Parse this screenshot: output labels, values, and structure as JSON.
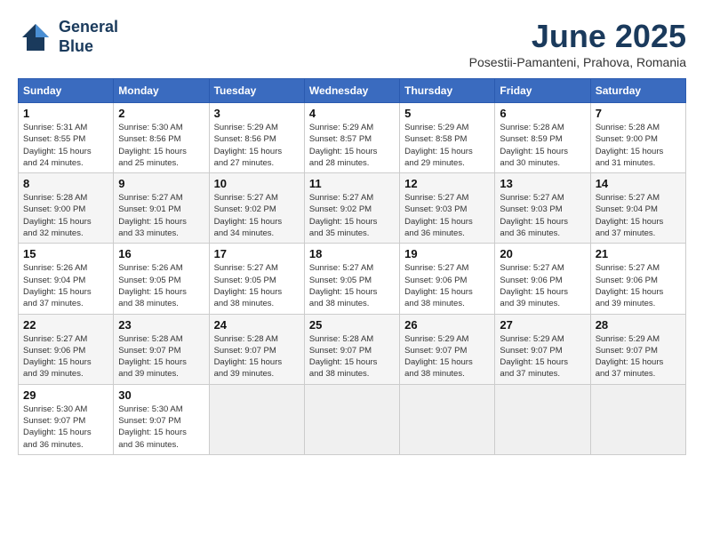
{
  "header": {
    "logo_line1": "General",
    "logo_line2": "Blue",
    "month": "June 2025",
    "location": "Posestii-Pamanteni, Prahova, Romania"
  },
  "weekdays": [
    "Sunday",
    "Monday",
    "Tuesday",
    "Wednesday",
    "Thursday",
    "Friday",
    "Saturday"
  ],
  "weeks": [
    [
      {
        "day": "1",
        "info": "Sunrise: 5:31 AM\nSunset: 8:55 PM\nDaylight: 15 hours\nand 24 minutes."
      },
      {
        "day": "2",
        "info": "Sunrise: 5:30 AM\nSunset: 8:56 PM\nDaylight: 15 hours\nand 25 minutes."
      },
      {
        "day": "3",
        "info": "Sunrise: 5:29 AM\nSunset: 8:56 PM\nDaylight: 15 hours\nand 27 minutes."
      },
      {
        "day": "4",
        "info": "Sunrise: 5:29 AM\nSunset: 8:57 PM\nDaylight: 15 hours\nand 28 minutes."
      },
      {
        "day": "5",
        "info": "Sunrise: 5:29 AM\nSunset: 8:58 PM\nDaylight: 15 hours\nand 29 minutes."
      },
      {
        "day": "6",
        "info": "Sunrise: 5:28 AM\nSunset: 8:59 PM\nDaylight: 15 hours\nand 30 minutes."
      },
      {
        "day": "7",
        "info": "Sunrise: 5:28 AM\nSunset: 9:00 PM\nDaylight: 15 hours\nand 31 minutes."
      }
    ],
    [
      {
        "day": "8",
        "info": "Sunrise: 5:28 AM\nSunset: 9:00 PM\nDaylight: 15 hours\nand 32 minutes."
      },
      {
        "day": "9",
        "info": "Sunrise: 5:27 AM\nSunset: 9:01 PM\nDaylight: 15 hours\nand 33 minutes."
      },
      {
        "day": "10",
        "info": "Sunrise: 5:27 AM\nSunset: 9:02 PM\nDaylight: 15 hours\nand 34 minutes."
      },
      {
        "day": "11",
        "info": "Sunrise: 5:27 AM\nSunset: 9:02 PM\nDaylight: 15 hours\nand 35 minutes."
      },
      {
        "day": "12",
        "info": "Sunrise: 5:27 AM\nSunset: 9:03 PM\nDaylight: 15 hours\nand 36 minutes."
      },
      {
        "day": "13",
        "info": "Sunrise: 5:27 AM\nSunset: 9:03 PM\nDaylight: 15 hours\nand 36 minutes."
      },
      {
        "day": "14",
        "info": "Sunrise: 5:27 AM\nSunset: 9:04 PM\nDaylight: 15 hours\nand 37 minutes."
      }
    ],
    [
      {
        "day": "15",
        "info": "Sunrise: 5:26 AM\nSunset: 9:04 PM\nDaylight: 15 hours\nand 37 minutes."
      },
      {
        "day": "16",
        "info": "Sunrise: 5:26 AM\nSunset: 9:05 PM\nDaylight: 15 hours\nand 38 minutes."
      },
      {
        "day": "17",
        "info": "Sunrise: 5:27 AM\nSunset: 9:05 PM\nDaylight: 15 hours\nand 38 minutes."
      },
      {
        "day": "18",
        "info": "Sunrise: 5:27 AM\nSunset: 9:05 PM\nDaylight: 15 hours\nand 38 minutes."
      },
      {
        "day": "19",
        "info": "Sunrise: 5:27 AM\nSunset: 9:06 PM\nDaylight: 15 hours\nand 38 minutes."
      },
      {
        "day": "20",
        "info": "Sunrise: 5:27 AM\nSunset: 9:06 PM\nDaylight: 15 hours\nand 39 minutes."
      },
      {
        "day": "21",
        "info": "Sunrise: 5:27 AM\nSunset: 9:06 PM\nDaylight: 15 hours\nand 39 minutes."
      }
    ],
    [
      {
        "day": "22",
        "info": "Sunrise: 5:27 AM\nSunset: 9:06 PM\nDaylight: 15 hours\nand 39 minutes."
      },
      {
        "day": "23",
        "info": "Sunrise: 5:28 AM\nSunset: 9:07 PM\nDaylight: 15 hours\nand 39 minutes."
      },
      {
        "day": "24",
        "info": "Sunrise: 5:28 AM\nSunset: 9:07 PM\nDaylight: 15 hours\nand 39 minutes."
      },
      {
        "day": "25",
        "info": "Sunrise: 5:28 AM\nSunset: 9:07 PM\nDaylight: 15 hours\nand 38 minutes."
      },
      {
        "day": "26",
        "info": "Sunrise: 5:29 AM\nSunset: 9:07 PM\nDaylight: 15 hours\nand 38 minutes."
      },
      {
        "day": "27",
        "info": "Sunrise: 5:29 AM\nSunset: 9:07 PM\nDaylight: 15 hours\nand 37 minutes."
      },
      {
        "day": "28",
        "info": "Sunrise: 5:29 AM\nSunset: 9:07 PM\nDaylight: 15 hours\nand 37 minutes."
      }
    ],
    [
      {
        "day": "29",
        "info": "Sunrise: 5:30 AM\nSunset: 9:07 PM\nDaylight: 15 hours\nand 36 minutes."
      },
      {
        "day": "30",
        "info": "Sunrise: 5:30 AM\nSunset: 9:07 PM\nDaylight: 15 hours\nand 36 minutes."
      },
      {
        "day": "",
        "info": ""
      },
      {
        "day": "",
        "info": ""
      },
      {
        "day": "",
        "info": ""
      },
      {
        "day": "",
        "info": ""
      },
      {
        "day": "",
        "info": ""
      }
    ]
  ]
}
